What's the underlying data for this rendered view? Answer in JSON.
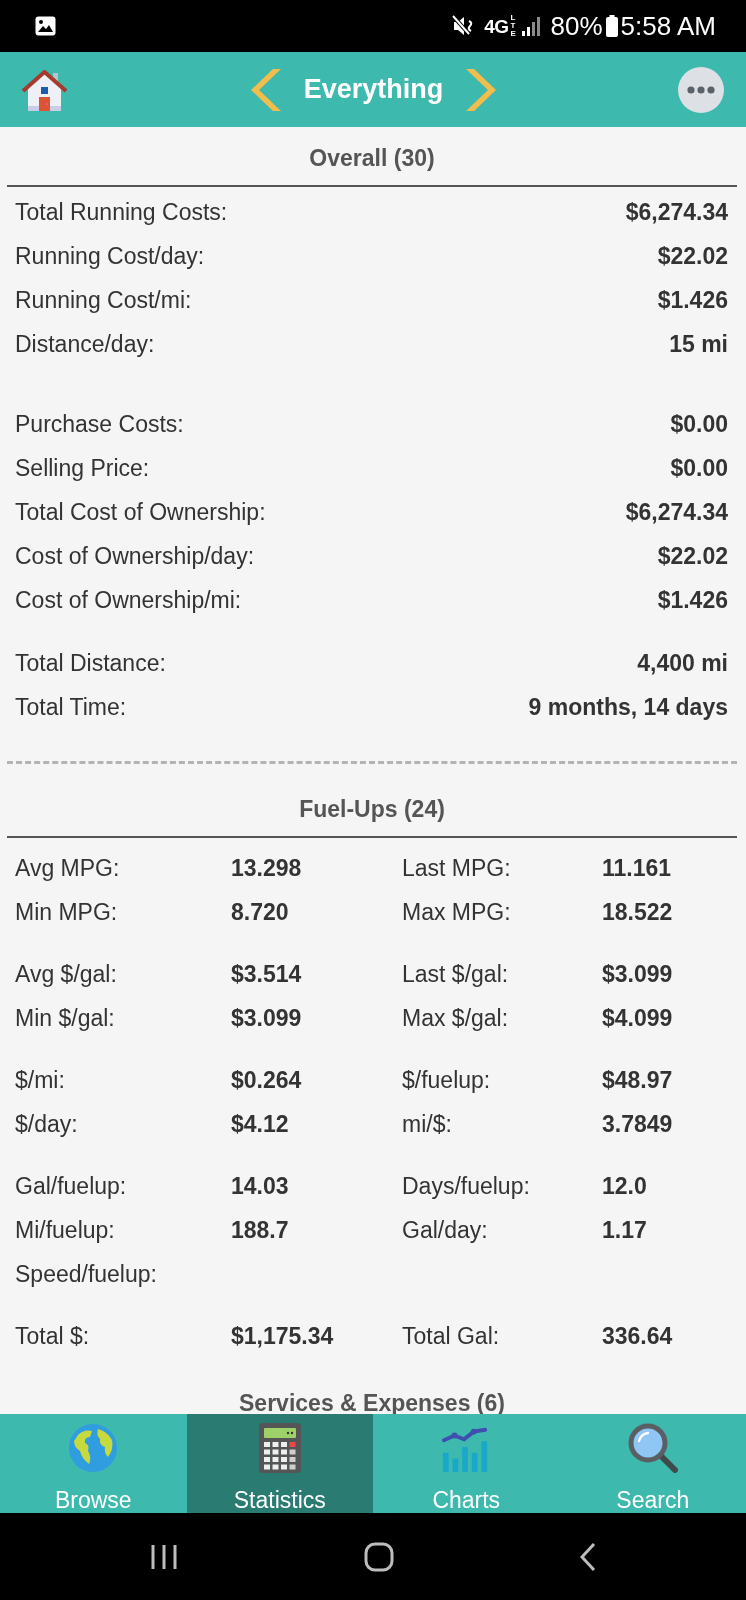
{
  "status_bar": {
    "network": "4G",
    "network_sub": "LTE",
    "battery": "80%",
    "time": "5:58 AM"
  },
  "header": {
    "title": "Everything"
  },
  "sections": [
    {
      "kind": "list",
      "title": "Overall (30)",
      "groups": [
        [
          {
            "label": "Total Running Costs:",
            "value": "$6,274.34"
          },
          {
            "label": "Running Cost/day:",
            "value": "$22.02"
          },
          {
            "label": "Running Cost/mi:",
            "value": "$1.426"
          },
          {
            "label": "Distance/day:",
            "value": "15 mi"
          }
        ],
        [
          {
            "label": "Purchase Costs:",
            "value": "$0.00"
          },
          {
            "label": "Selling Price:",
            "value": "$0.00"
          },
          {
            "label": "Total Cost of Ownership:",
            "value": "$6,274.34"
          },
          {
            "label": "Cost of Ownership/day:",
            "value": "$22.02"
          },
          {
            "label": "Cost of Ownership/mi:",
            "value": "$1.426"
          }
        ],
        [
          {
            "label": "Total Distance:",
            "value": "4,400 mi"
          },
          {
            "label": "Total Time:",
            "value": "9 months, 14 days"
          }
        ]
      ]
    },
    {
      "kind": "grid",
      "title": "Fuel-Ups (24)",
      "groups": [
        [
          [
            {
              "label": "Avg MPG:",
              "value": "13.298"
            },
            {
              "label": "Last MPG:",
              "value": "11.161"
            }
          ],
          [
            {
              "label": "Min MPG:",
              "value": "8.720"
            },
            {
              "label": "Max MPG:",
              "value": "18.522"
            }
          ]
        ],
        [
          [
            {
              "label": "Avg $/gal:",
              "value": "$3.514"
            },
            {
              "label": "Last $/gal:",
              "value": "$3.099"
            }
          ],
          [
            {
              "label": "Min $/gal:",
              "value": "$3.099"
            },
            {
              "label": "Max $/gal:",
              "value": "$4.099"
            }
          ]
        ],
        [
          [
            {
              "label": "$/mi:",
              "value": "$0.264"
            },
            {
              "label": "$/fuelup:",
              "value": "$48.97"
            }
          ],
          [
            {
              "label": "$/day:",
              "value": "$4.12"
            },
            {
              "label": "mi/$:",
              "value": "3.7849"
            }
          ]
        ],
        [
          [
            {
              "label": "Gal/fuelup:",
              "value": "14.03"
            },
            {
              "label": "Days/fuelup:",
              "value": "12.0"
            }
          ],
          [
            {
              "label": "Mi/fuelup:",
              "value": "188.7"
            },
            {
              "label": "Gal/day:",
              "value": "1.17"
            }
          ],
          [
            {
              "label": "Speed/fuelup:"
            }
          ]
        ],
        [
          [
            {
              "label": "Total $:",
              "value": "$1,175.34"
            },
            {
              "label": "Total Gal:",
              "value": "336.64"
            }
          ]
        ]
      ]
    },
    {
      "kind": "list",
      "title": "Services & Expenses (6)"
    }
  ],
  "bottom_nav": {
    "tabs": [
      {
        "label": "Browse",
        "selected": false
      },
      {
        "label": "Statistics",
        "selected": true
      },
      {
        "label": "Charts",
        "selected": false
      },
      {
        "label": "Search",
        "selected": false
      }
    ]
  }
}
